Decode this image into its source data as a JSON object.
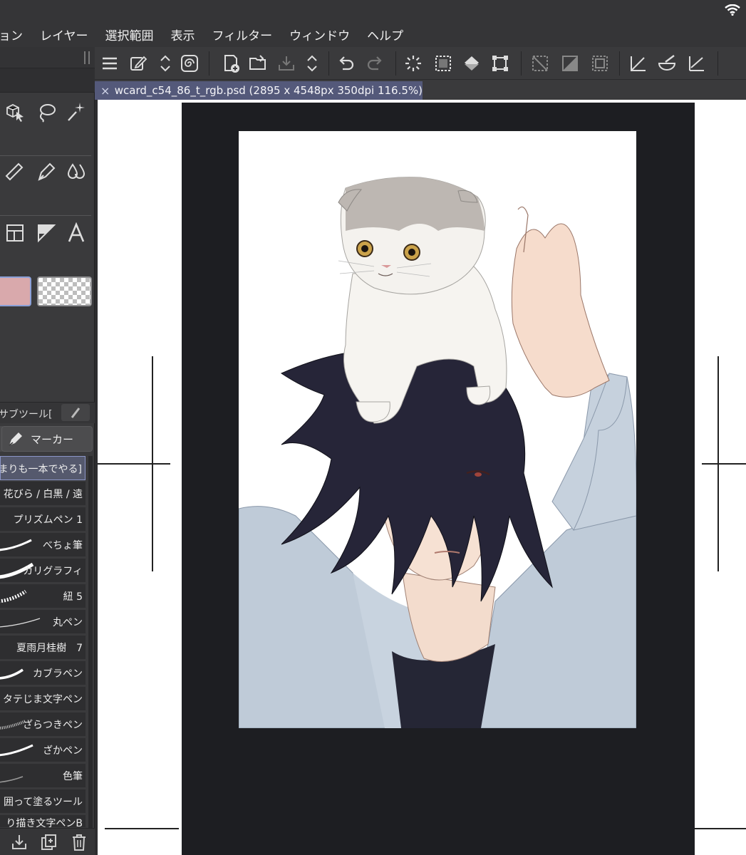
{
  "menubar": {
    "items": [
      "ョン",
      "レイヤー",
      "選択範囲",
      "表示",
      "フィルター",
      "ウィンドウ",
      "ヘルプ"
    ]
  },
  "document": {
    "tab_title": "wcard_c54_86_t_rgb.psd (2895 x 4548px 350dpi 116.5%)",
    "close_glyph": "×"
  },
  "subtool": {
    "title": "サブツール[",
    "active_tab": "マーカー",
    "brushes": [
      {
        "name": "まりも一本でやる]",
        "selected": true
      },
      {
        "name": "花びら / 白黒 / 遠",
        "selected": false
      },
      {
        "name": "プリズムペン 1",
        "selected": false
      },
      {
        "name": "べちょ筆",
        "selected": false
      },
      {
        "name": "カリグラフィ",
        "selected": false
      },
      {
        "name": "紐 5",
        "selected": false
      },
      {
        "name": "丸ペン",
        "selected": false
      },
      {
        "name": "夏雨月桂樹　7",
        "selected": false
      },
      {
        "name": "カブラペン",
        "selected": false
      },
      {
        "name": "タテじま文字ペン",
        "selected": false
      },
      {
        "name": "ざらつきペン",
        "selected": false
      },
      {
        "name": "ざかペン",
        "selected": false
      },
      {
        "name": "色筆",
        "selected": false
      },
      {
        "name": "囲って塗るツール",
        "selected": false
      },
      {
        "name": "り描き文字ペンB",
        "selected": false
      }
    ]
  },
  "colors": {
    "main_color": "#d9a9ac",
    "sub_color": "transparent",
    "ui_dark": "#3a3a3c",
    "tab_active": "#54597a",
    "selection_accent": "#8c96c8"
  },
  "icons": {
    "toolbar": [
      "menu-icon",
      "edit-icon",
      "up-down-arrows-icon",
      "spiral-icon",
      "new-file-icon",
      "open-folder-icon",
      "save-icon",
      "up-down-arrows-icon",
      "undo-icon",
      "redo-icon",
      "loading-icon",
      "select-all-icon",
      "fill-bucket-icon",
      "transform-icon",
      "deselect-icon",
      "invert-selection-icon",
      "selection-border-icon",
      "ruler-tool-icon",
      "bowl-icon",
      "snap-icon"
    ],
    "tools": [
      "object-select-icon",
      "lasso-icon",
      "magic-wand-icon",
      "eraser-icon",
      "pen-icon",
      "water-drop-icon",
      "frame-icon",
      "ruler-icon",
      "text-icon"
    ]
  }
}
